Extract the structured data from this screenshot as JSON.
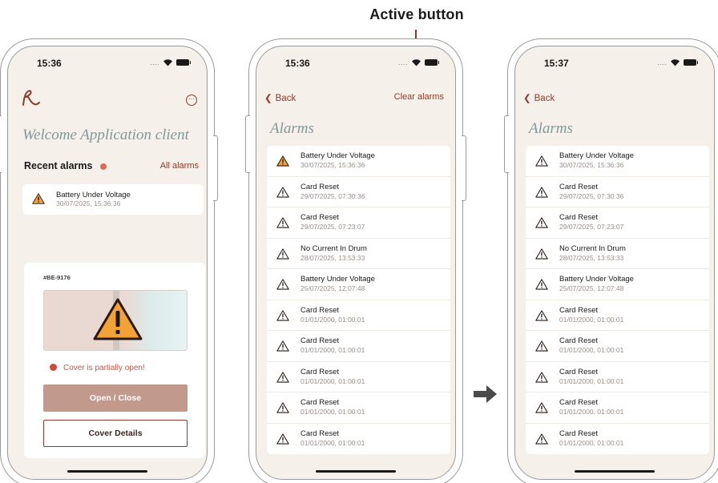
{
  "annotation": {
    "label": "Active button"
  },
  "colors": {
    "accent": "#8e3a2a",
    "background": "#f6f0ea",
    "warning_filled": "#f2a236",
    "error": "#d04a3a",
    "button": "#c19a8d"
  },
  "phone1": {
    "status_time": "15:36",
    "status_dots": "....",
    "welcome": "Welcome Application client",
    "recent_title": "Recent alarms",
    "all_alarms_link": "All alarms",
    "recent_alarm": {
      "title": "Battery Under Voltage",
      "time": "30/07/2025, 15:36:36",
      "icon": "warning-filled-icon"
    },
    "cover": {
      "id": "#BE-9176",
      "status": "Cover is partially open!",
      "primary_button": "Open / Close",
      "secondary_button": "Cover Details"
    }
  },
  "phone2": {
    "status_time": "15:36",
    "status_dots": "....",
    "back": "Back",
    "clear_alarms": "Clear alarms",
    "title": "Alarms",
    "alarms": [
      {
        "title": "Battery Under Voltage",
        "time": "30/07/2025, 15:36:36",
        "icon": "warning-filled-icon"
      },
      {
        "title": "Card Reset",
        "time": "29/07/2025, 07:30:36",
        "icon": "warning-outline-icon"
      },
      {
        "title": "Card Reset",
        "time": "29/07/2025, 07:23:07",
        "icon": "warning-outline-icon"
      },
      {
        "title": "No Current In Drum",
        "time": "28/07/2025, 13:53:33",
        "icon": "warning-outline-icon"
      },
      {
        "title": "Battery Under Voltage",
        "time": "25/07/2025, 12:07:48",
        "icon": "warning-outline-icon"
      },
      {
        "title": "Card Reset",
        "time": "01/01/2000, 01:00:01",
        "icon": "warning-outline-icon"
      },
      {
        "title": "Card Reset",
        "time": "01/01/2000, 01:00:01",
        "icon": "warning-outline-icon"
      },
      {
        "title": "Card Reset",
        "time": "01/01/2000, 01:00:01",
        "icon": "warning-outline-icon"
      },
      {
        "title": "Card Reset",
        "time": "01/01/2000, 01:00:01",
        "icon": "warning-outline-icon"
      },
      {
        "title": "Card Reset",
        "time": "01/01/2000, 01:00:01",
        "icon": "warning-outline-icon"
      }
    ]
  },
  "phone3": {
    "status_time": "15:37",
    "status_dots": "....",
    "back": "Back",
    "title": "Alarms",
    "alarms": [
      {
        "title": "Battery Under Voltage",
        "time": "30/07/2025, 15:36:36",
        "icon": "warning-outline-icon"
      },
      {
        "title": "Card Reset",
        "time": "29/07/2025, 07:30:36",
        "icon": "warning-outline-icon"
      },
      {
        "title": "Card Reset",
        "time": "29/07/2025, 07:23:07",
        "icon": "warning-outline-icon"
      },
      {
        "title": "No Current In Drum",
        "time": "28/07/2025, 13:53:33",
        "icon": "warning-outline-icon"
      },
      {
        "title": "Battery Under Voltage",
        "time": "25/07/2025, 12:07:48",
        "icon": "warning-outline-icon"
      },
      {
        "title": "Card Reset",
        "time": "01/01/2000, 01:00:01",
        "icon": "warning-outline-icon"
      },
      {
        "title": "Card Reset",
        "time": "01/01/2000, 01:00:01",
        "icon": "warning-outline-icon"
      },
      {
        "title": "Card Reset",
        "time": "01/01/2000, 01:00:01",
        "icon": "warning-outline-icon"
      },
      {
        "title": "Card Reset",
        "time": "01/01/2000, 01:00:01",
        "icon": "warning-outline-icon"
      },
      {
        "title": "Card Reset",
        "time": "01/01/2000, 01:00:01",
        "icon": "warning-outline-icon"
      }
    ]
  }
}
